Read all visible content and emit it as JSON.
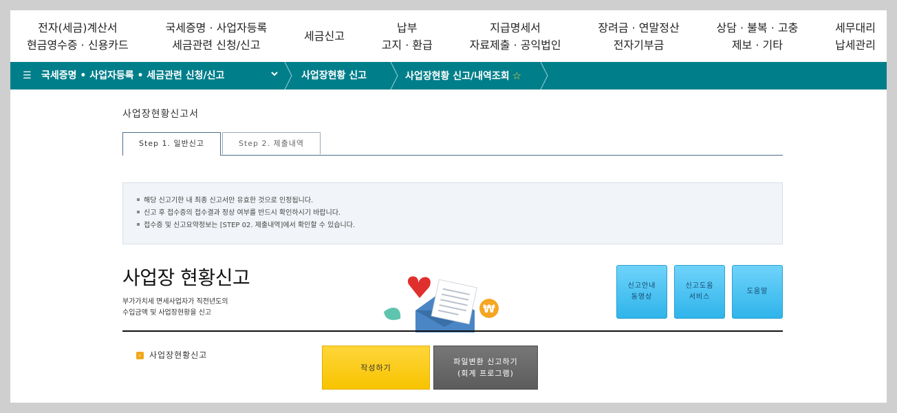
{
  "top_menu": [
    {
      "line1": "전자(세금)계산서",
      "line2": "현금영수증 · 신용카드"
    },
    {
      "line1": "국세증명 · 사업자등록",
      "line2": "세금관련 신청/신고"
    },
    {
      "line1": "세금신고",
      "line2": ""
    },
    {
      "line1": "납부",
      "line2": "고지 · 환급"
    },
    {
      "line1": "지급명세서",
      "line2": "자료제출 · 공익법인"
    },
    {
      "line1": "장려금 · 연말정산",
      "line2": "전자기부금"
    },
    {
      "line1": "상담 · 불복 · 고충",
      "line2": "제보 · 기타"
    },
    {
      "line1": "세무대리",
      "line2": "납세관리"
    }
  ],
  "breadcrumb": {
    "menu_icon": "☰",
    "item1": "국세증명 • 사업자등록 • 세금관련 신청/신고",
    "chevron": "chevron-down-icon",
    "item2": "사업장현황 신고",
    "item3": "사업장현황 신고/내역조회",
    "star": "☆",
    "bar_color": "#007f8a"
  },
  "page_title": "사업장현황신고서",
  "tabs": [
    {
      "label": "Step 1. 일반신고",
      "active": true
    },
    {
      "label": "Step 2. 제출내역",
      "active": false
    }
  ],
  "notice": [
    "해당 신고기한 내 최종 신고서만 유효한 것으로 인정됩니다.",
    "신고 후 접수증의 접수결과 정상 여부를 반드시 확인하시기 바랍니다.",
    "접수증 및 신고요약정보는 [STEP 02. 제출내역]에서 확인할 수 있습니다."
  ],
  "main": {
    "heading": "사업장 현황신고",
    "desc_line1": "부가가치세 면세사업자가 직전년도의",
    "desc_line2": "수입금액 및 사업장현황을 신고"
  },
  "help_buttons": [
    {
      "line1": "신고안내",
      "line2": "동영상"
    },
    {
      "line1": "신고도움",
      "line2": "서비스"
    },
    {
      "line1": "도움말",
      "line2": ""
    }
  ],
  "sub_item": "사업장현황신고",
  "actions": {
    "write": "작성하기",
    "file_line1": "파일변환 신고하기",
    "file_line2": "(회계 프로그램)"
  }
}
